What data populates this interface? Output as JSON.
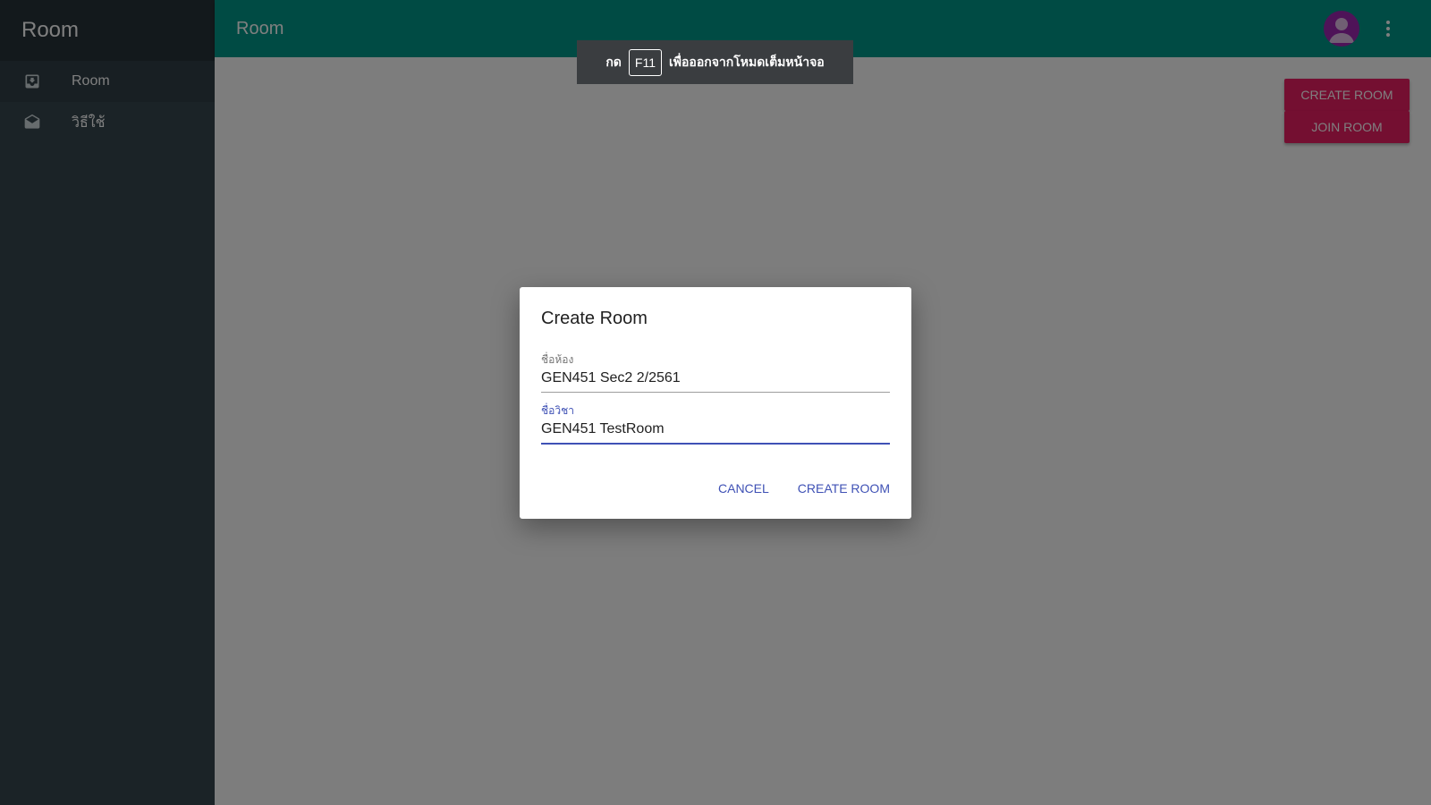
{
  "sidebar": {
    "brand": "Room",
    "items": [
      {
        "label": "Room",
        "icon": "inbox-icon"
      },
      {
        "label": "วิธีใช้",
        "icon": "mail-open-icon"
      }
    ]
  },
  "header": {
    "title": "Room",
    "avatar_icon": "account-icon",
    "menu_icon": "more-vert-icon"
  },
  "main": {
    "create_room_label": "CREATE ROOM",
    "join_room_label": "JOIN ROOM"
  },
  "toast": {
    "prefix": "กด",
    "key": "F11",
    "suffix": "เพื่อออกจากโหมดเต็มหน้าจอ"
  },
  "dialog": {
    "title": "Create Room",
    "room_name_label": "ชื่อห้อง",
    "room_name_value": "GEN451 Sec2 2/2561",
    "subject_label": "ชื่อวิชา",
    "subject_value": "GEN451 TestRoom",
    "cancel_label": "CANCEL",
    "submit_label": "CREATE ROOM"
  },
  "colors": {
    "appbar": "#009688",
    "sidebar": "#37474f",
    "accent_button": "#e91e63",
    "dialog_primary": "#3f51b5"
  }
}
